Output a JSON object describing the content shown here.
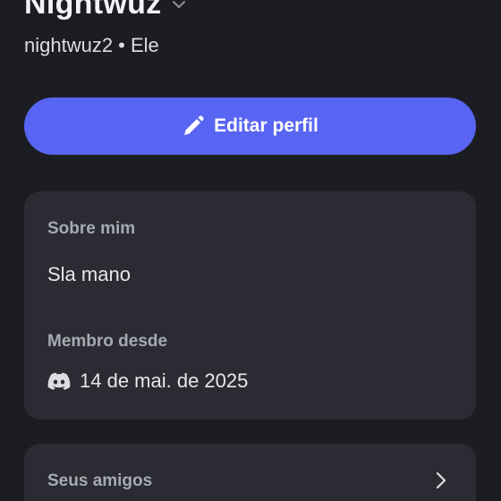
{
  "profile": {
    "display_name": "Nightwuz",
    "handle_line": "nightwuz2 • Ele"
  },
  "actions": {
    "edit_profile_label": "Editar perfil"
  },
  "about": {
    "heading": "Sobre mim",
    "text": "Sla mano",
    "member_since_heading": "Membro desde",
    "member_since_date": "14 de mai. de 2025"
  },
  "friends": {
    "heading": "Seus amigos"
  },
  "colors": {
    "background": "#1c1d23",
    "card": "#2b2c33",
    "accent": "#5865f2"
  },
  "icons": {
    "display_name_toggle": "chevron-down-icon",
    "edit": "pencil-icon",
    "member_since": "discord-logo-icon",
    "friends_link": "chevron-right-icon"
  }
}
